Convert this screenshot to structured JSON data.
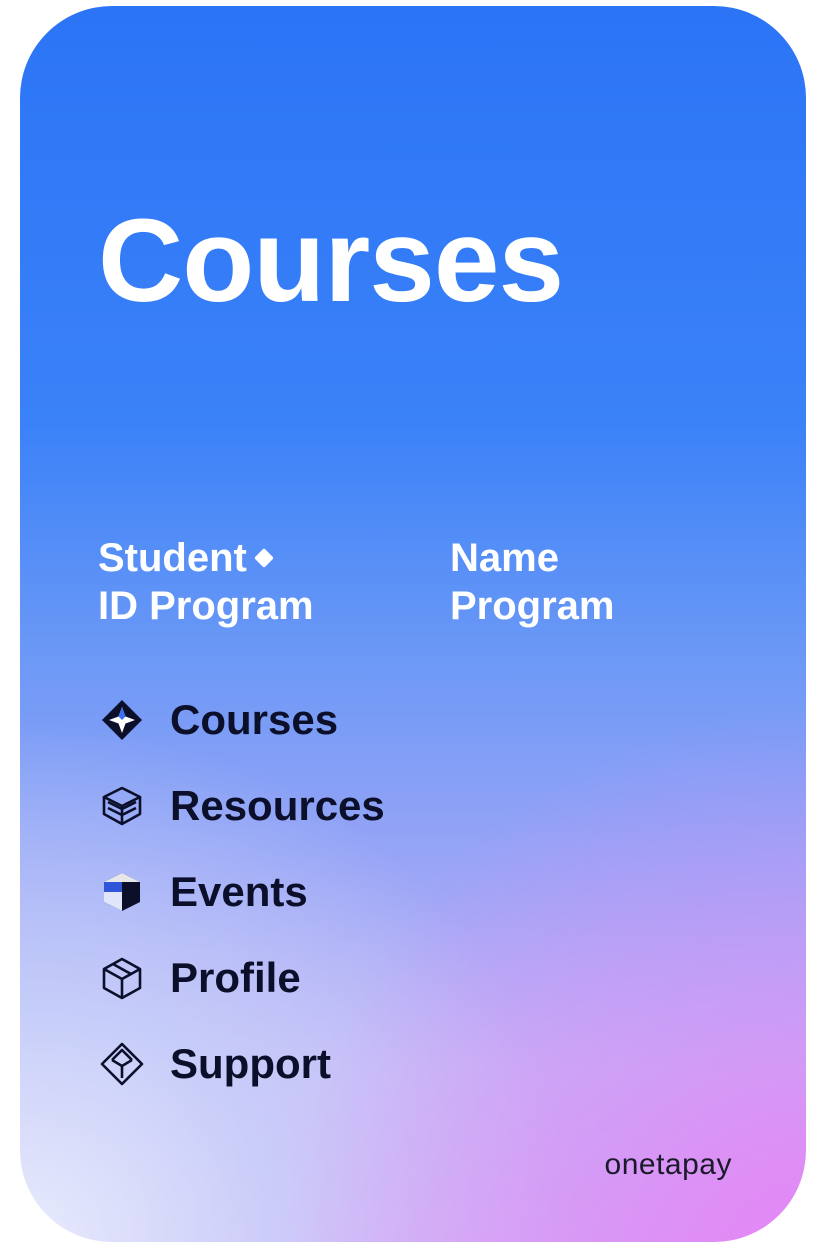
{
  "card": {
    "title": "Courses",
    "student_id": {
      "line1": "Student",
      "line2": "ID Program",
      "icon": "diamond-icon"
    },
    "name": {
      "line1": "Name",
      "line2": "Program"
    },
    "menu": [
      {
        "label": "Courses",
        "icon": "star-diamond-icon"
      },
      {
        "label": "Resources",
        "icon": "layers-icon"
      },
      {
        "label": "Events",
        "icon": "cube-icon"
      },
      {
        "label": "Profile",
        "icon": "box-icon"
      },
      {
        "label": "Support",
        "icon": "diamond-outline-icon"
      }
    ],
    "brand": "onetapay"
  },
  "colors": {
    "title": "#ffffff",
    "menu_text": "#0b0f2a",
    "gradient_top": "#2b74f6",
    "gradient_bottom_right": "#e082f5",
    "gradient_bottom_left": "#e8ecfc"
  }
}
